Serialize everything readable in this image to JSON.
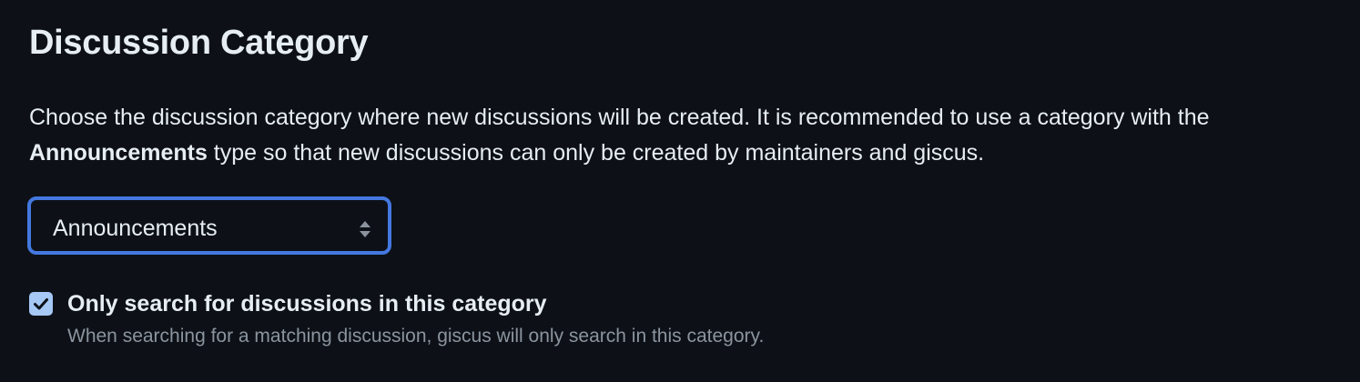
{
  "section": {
    "title": "Discussion Category",
    "description_before": "Choose the discussion category where new discussions will be created. It is recommended to use a category with the ",
    "description_bold": "Announcements",
    "description_after": " type so that new discussions can only be created by maintainers and giscus."
  },
  "category_select": {
    "selected": "Announcements",
    "icon": "updown-arrows-icon"
  },
  "strict_search": {
    "checked": true,
    "label": "Only search for discussions in this category",
    "hint": "When searching for a matching discussion, giscus will only search in this category."
  },
  "colors": {
    "background": "#0d1117",
    "text": "#e6edf3",
    "muted": "#8b949e",
    "focus_ring": "#4478e0",
    "checkbox": "#a5c8f5"
  }
}
